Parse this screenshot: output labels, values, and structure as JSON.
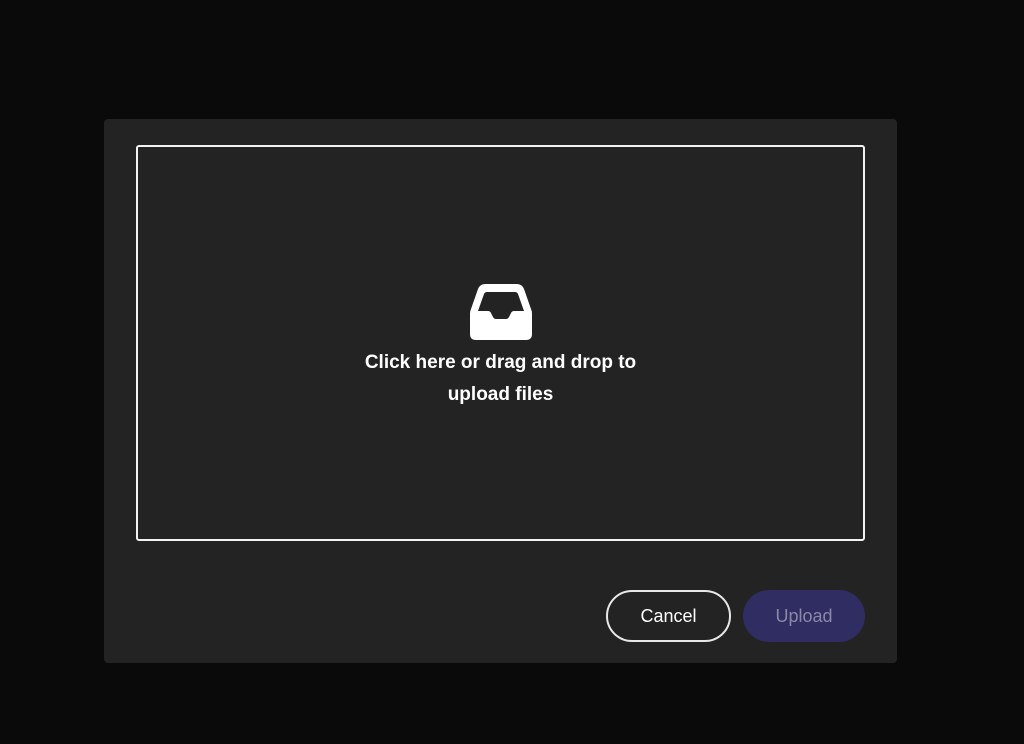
{
  "dialog": {
    "dropzone": {
      "icon": "inbox-tray-icon",
      "text": "Click here or drag and drop to upload files"
    },
    "actions": {
      "cancel_label": "Cancel",
      "upload_label": "Upload",
      "upload_state": "disabled"
    }
  },
  "colors": {
    "backdrop": "#0a0a0a",
    "dialog_bg": "#232323",
    "border": "#f2f2f2",
    "upload_bg": "#302d63",
    "upload_text": "#8a88a8"
  }
}
